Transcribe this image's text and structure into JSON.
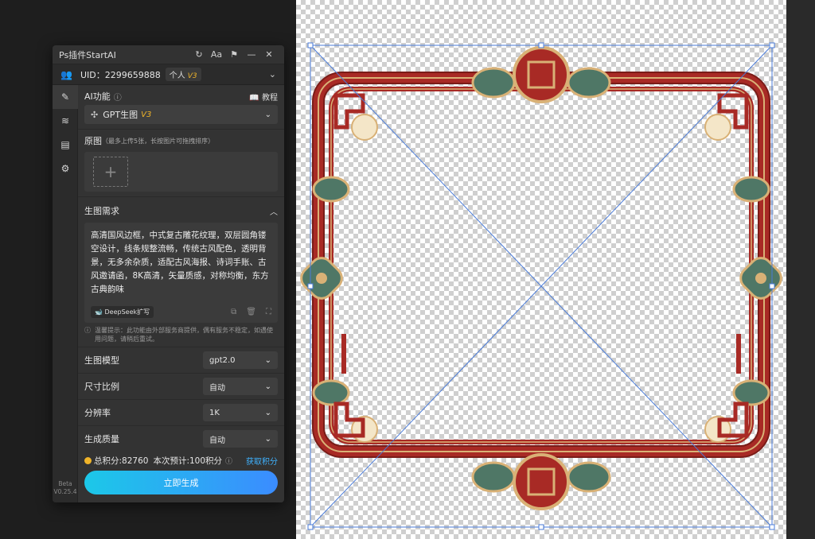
{
  "panel": {
    "title": "Ps插件StartAI",
    "refresh_icon": "↻",
    "font_icon": "Aa",
    "pin_icon": "⚑",
    "minimize_icon": "—",
    "close_icon": "✕"
  },
  "user": {
    "uid": "UID：2299659888",
    "plan": "个人",
    "plan_tier": "V3",
    "expand_icon": "⌄"
  },
  "rail": {
    "version_line1": "Beta",
    "version_line2": "V0.25.4"
  },
  "ai": {
    "section_label": "AI功能",
    "info_icon": "ⓘ",
    "tutorial_label": "教程",
    "function_value": "GPT生图",
    "function_tier": "V3"
  },
  "source": {
    "label": "原图",
    "hint": "（最多上传5张，长按图片可拖拽排序）"
  },
  "prompt": {
    "label": "生图需求",
    "text": "高清国风边框，中式复古雕花纹理，双层圆角镂空设计，线条规整流畅，传统古风配色，透明背景，无多余杂质，适配古风海报、诗词手账、古风邀请函，8K高清，矢量质感，对称均衡，东方古典韵味",
    "deepseek_label": "DeepSeek扩写"
  },
  "tip": {
    "text": "温馨提示：此功能由外部服务商提供，偶有服务不稳定，如遇使用问题，请稍后重试。"
  },
  "settings": [
    {
      "label": "生图模型",
      "value": "gpt2.0"
    },
    {
      "label": "尺寸比例",
      "value": "自动"
    },
    {
      "label": "分辨率",
      "value": "1K"
    },
    {
      "label": "生成质量",
      "value": "自动"
    }
  ],
  "points": {
    "total": "总积分:82760",
    "estimate": "本次预计:100积分",
    "get_label": "获取积分"
  },
  "generate_label": "立即生成",
  "colors": {
    "accent": "#3b8cff",
    "frame_red": "#a82a25",
    "frame_gold": "#d9b176",
    "frame_jade": "#4f7766"
  }
}
